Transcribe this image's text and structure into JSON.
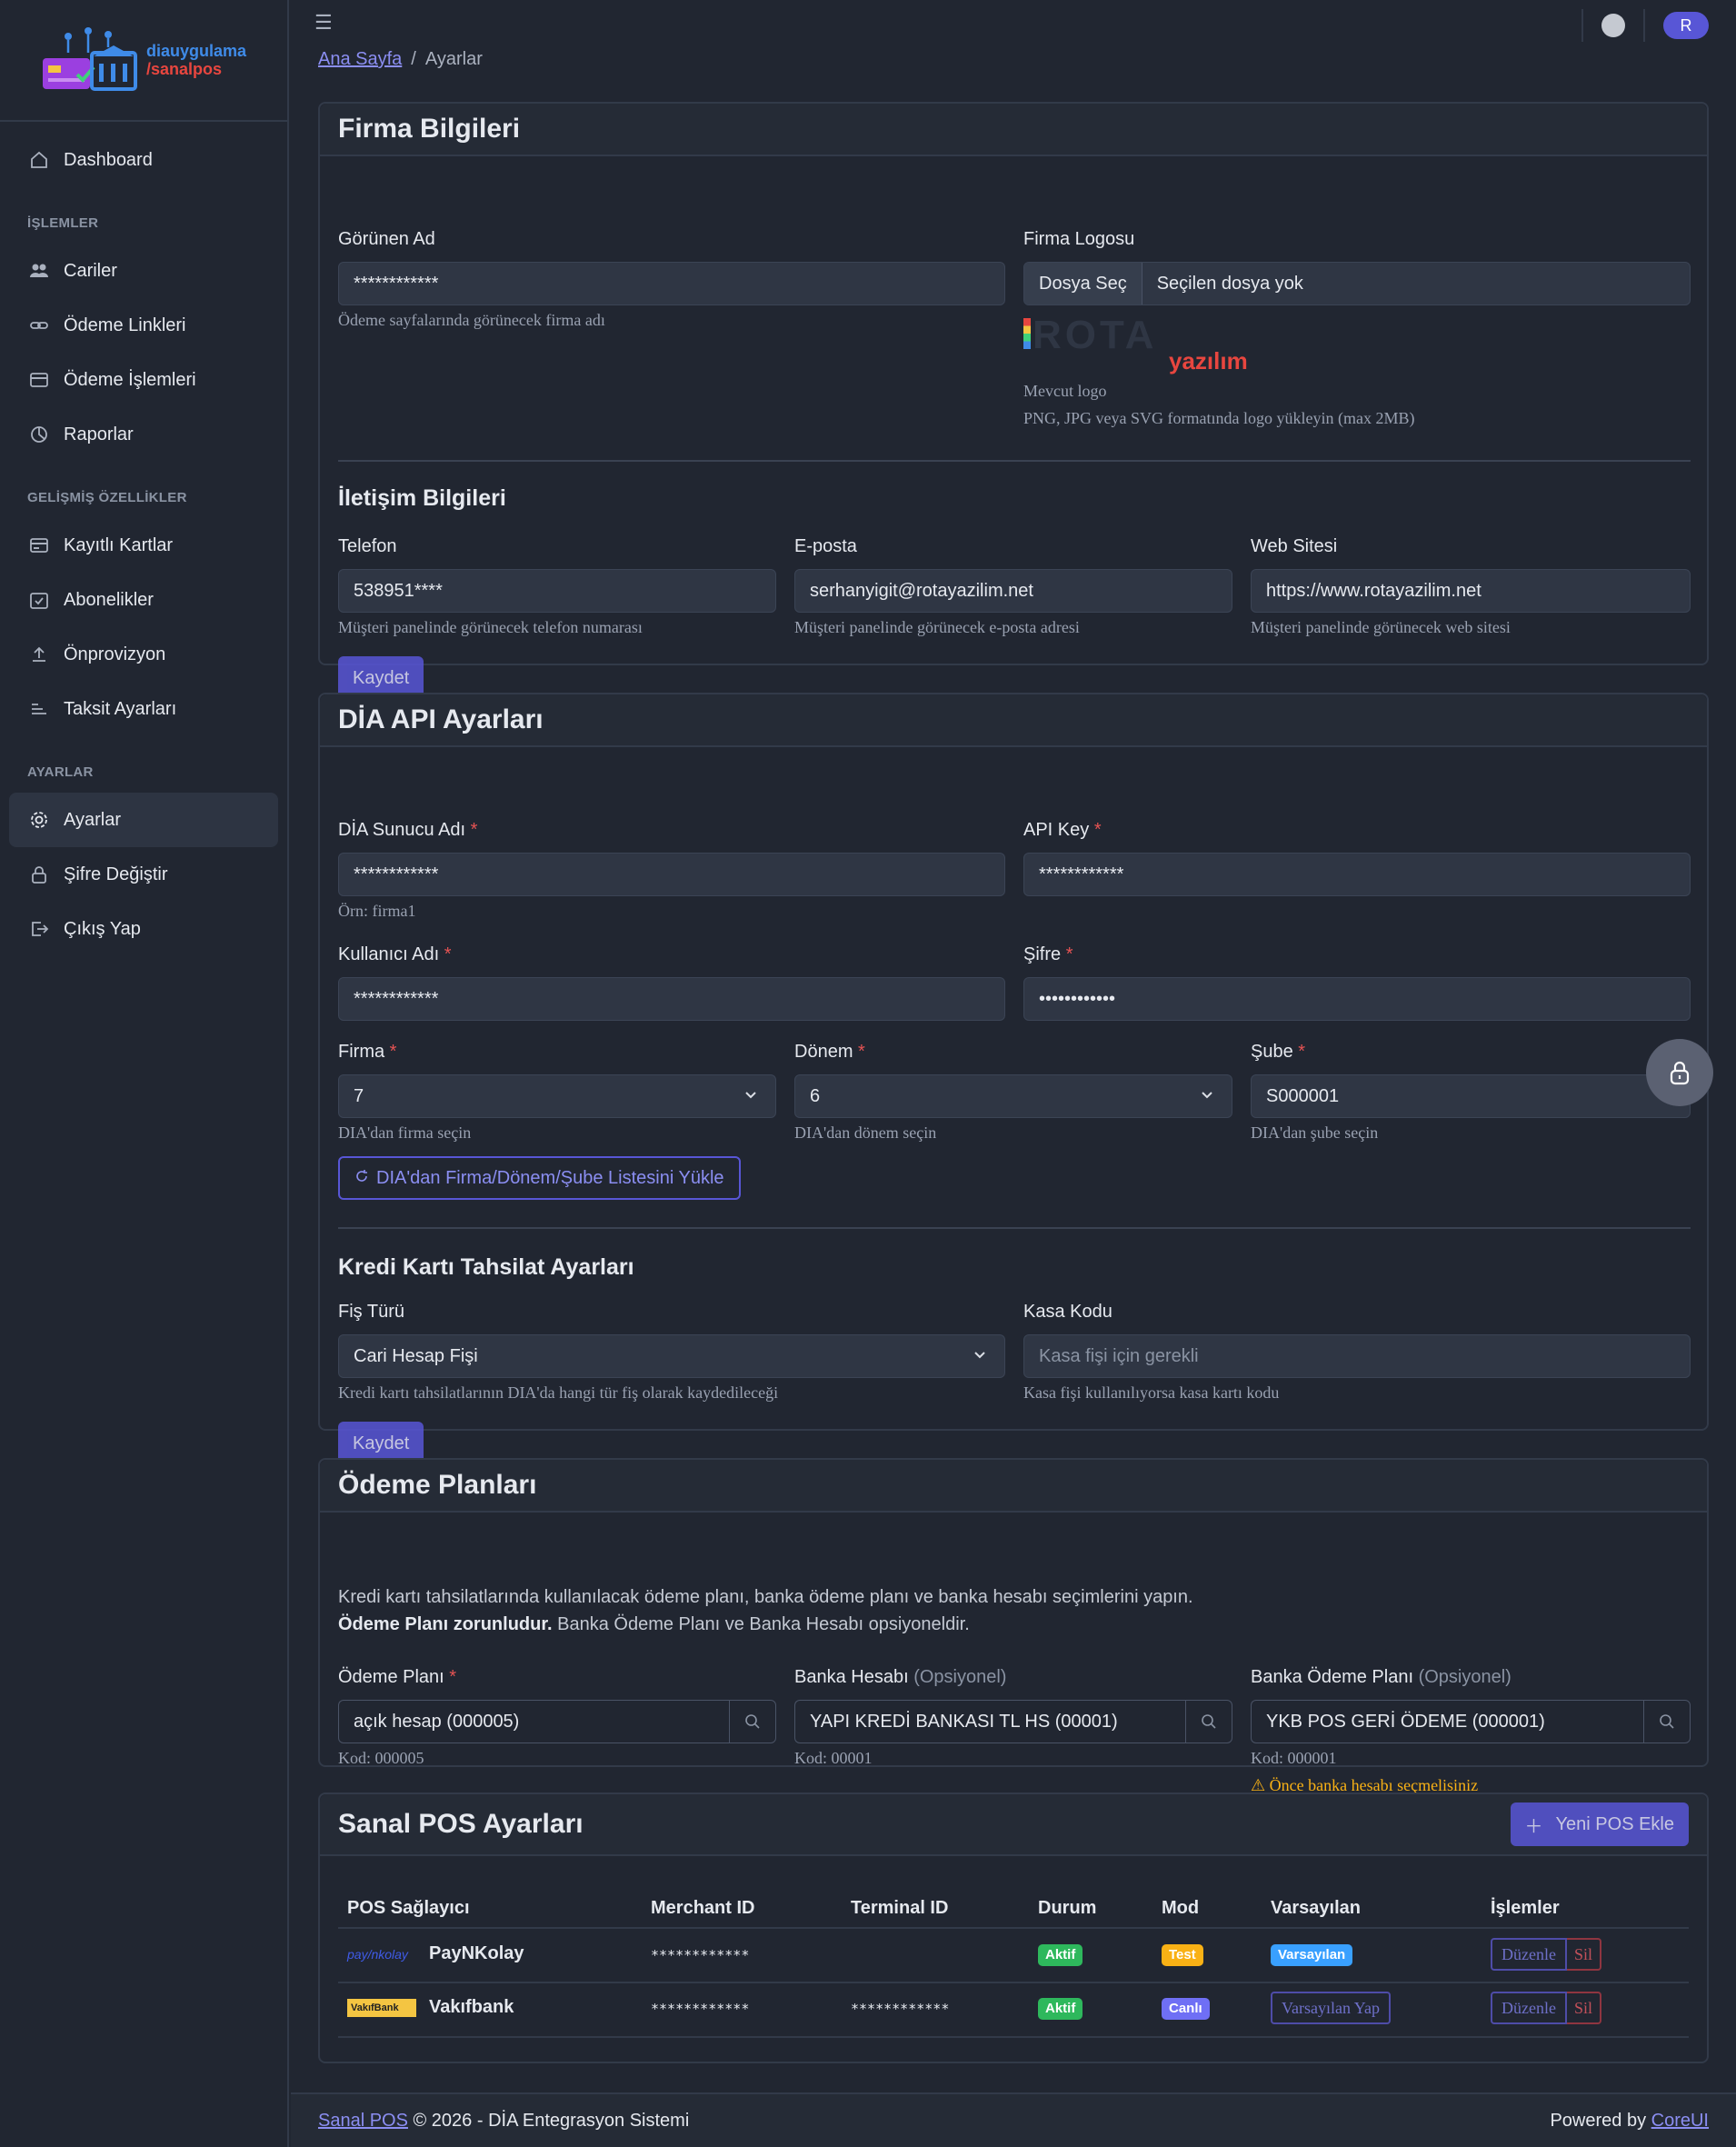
{
  "brand": {
    "line1": "diauygulama",
    "line2": "/sanalpos"
  },
  "sidebar": {
    "dashboard": "Dashboard",
    "section_islemler": "İŞLEMLER",
    "cariler": "Cariler",
    "odeme_linkleri": "Ödeme Linkleri",
    "odeme_islemleri": "Ödeme İşlemleri",
    "raporlar": "Raporlar",
    "section_gelismis": "GELİŞMİŞ ÖZELLİKLER",
    "kayitli_kartlar": "Kayıtlı Kartlar",
    "abonelikler": "Abonelikler",
    "onprovizyon": "Önprovizyon",
    "taksit_ayarlari": "Taksit Ayarları",
    "section_ayarlar": "AYARLAR",
    "ayarlar": "Ayarlar",
    "sifre_degistir": "Şifre Değiştir",
    "cikis_yap": "Çıkış Yap"
  },
  "header": {
    "avatar": "R"
  },
  "breadcrumb": {
    "home": "Ana Sayfa",
    "sep": "/",
    "current": "Ayarlar"
  },
  "firma": {
    "title": "Firma Bilgileri",
    "gorunen_ad_label": "Görünen Ad",
    "gorunen_ad_value": "************",
    "gorunen_ad_help": "Ödeme sayfalarında görünecek firma adı",
    "logo_label": "Firma Logosu",
    "file_btn": "Dosya Seç",
    "file_text": "Seçilen dosya yok",
    "logo_word": "ROTA",
    "logo_sub": "yazılım",
    "mevcut_logo": "Mevcut logo",
    "logo_help": "PNG, JPG veya SVG formatında logo yükleyin (max 2MB)",
    "iletisim_title": "İletişim Bilgileri",
    "telefon_label": "Telefon",
    "telefon_value": "538951****",
    "telefon_help": "Müşteri panelinde görünecek telefon numarası",
    "eposta_label": "E-posta",
    "eposta_value": "serhanyigit@rotayazilim.net",
    "eposta_help": "Müşteri panelinde görünecek e-posta adresi",
    "web_label": "Web Sitesi",
    "web_value": "https://www.rotayazilim.net",
    "web_help": "Müşteri panelinde görünecek web sitesi",
    "kaydet": "Kaydet"
  },
  "dia": {
    "title": "DİA API Ayarları",
    "sunucu_label": "DİA Sunucu Adı",
    "sunucu_value": "************",
    "sunucu_help": "Örn: firma1",
    "apikey_label": "API Key",
    "apikey_value": "************",
    "kullanici_label": "Kullanıcı Adı",
    "kullanici_value": "************",
    "sifre_label": "Şifre",
    "sifre_value": "••••••••••••",
    "firma_label": "Firma",
    "firma_value": "7",
    "firma_help": "DIA'dan firma seçin",
    "donem_label": "Dönem",
    "donem_value": "6",
    "donem_help": "DIA'dan dönem seçin",
    "sube_label": "Şube",
    "sube_value": "S000001",
    "sube_help": "DIA'dan şube seçin",
    "yukle_btn": "DIA'dan Firma/Dönem/Şube Listesini Yükle",
    "kredi_title": "Kredi Kartı Tahsilat Ayarları",
    "fis_label": "Fiş Türü",
    "fis_value": "Cari Hesap Fişi",
    "fis_help": "Kredi kartı tahsilatlarının DIA'da hangi tür fiş olarak kaydedileceği",
    "kasa_label": "Kasa Kodu",
    "kasa_placeholder": "Kasa fişi için gerekli",
    "kasa_help": "Kasa fişi kullanılıyorsa kasa kartı kodu",
    "kaydet": "Kaydet",
    "req": "*"
  },
  "planlar": {
    "title": "Ödeme Planları",
    "desc1": "Kredi kartı tahsilatlarında kullanılacak ödeme planı, banka ödeme planı ve banka hesabı seçimlerini yapın.",
    "desc2_bold": "Ödeme Planı zorunludur.",
    "desc2_rest": " Banka Ödeme Planı ve Banka Hesabı opsiyoneldir.",
    "odeme_label": "Ödeme Planı",
    "odeme_value": "açık hesap (000005)",
    "odeme_kod": "Kod: 000005",
    "banka_hesap_label": "Banka Hesabı",
    "opsiyonel": "(Opsiyonel)",
    "banka_hesap_value": "YAPI KREDİ BANKASI TL HS (00001)",
    "banka_hesap_kod": "Kod: 00001",
    "banka_plan_label": "Banka Ödeme Planı",
    "banka_plan_value": "YKB POS GERİ ÖDEME (000001)",
    "banka_plan_kod": "Kod: 000001",
    "warning": "Önce banka hesabı seçmelisiniz"
  },
  "pos": {
    "title": "Sanal POS Ayarları",
    "add_btn": "Yeni POS Ekle",
    "columns": [
      "POS Sağlayıcı",
      "Merchant ID",
      "Terminal ID",
      "Durum",
      "Mod",
      "Varsayılan",
      "İşlemler"
    ],
    "rows": [
      {
        "logo": "pay/nkolay",
        "name": "PayNKolay",
        "merchant": "************",
        "terminal": "",
        "durum": "Aktif",
        "mod": "Test",
        "varsayilan": "Varsayılan",
        "edit": "Düzenle",
        "delete": "Sil"
      },
      {
        "logo": "VakıfBank",
        "name": "Vakıfbank",
        "merchant": "************",
        "terminal": "************",
        "durum": "Aktif",
        "mod": "Canlı",
        "varsayilan": "Varsayılan Yap",
        "edit": "Düzenle",
        "delete": "Sil"
      }
    ]
  },
  "footer": {
    "link": "Sanal POS",
    "text": " © 2026 - DİA Entegrasyon Sistemi",
    "powered": "Powered by ",
    "coreui": "CoreUI"
  }
}
